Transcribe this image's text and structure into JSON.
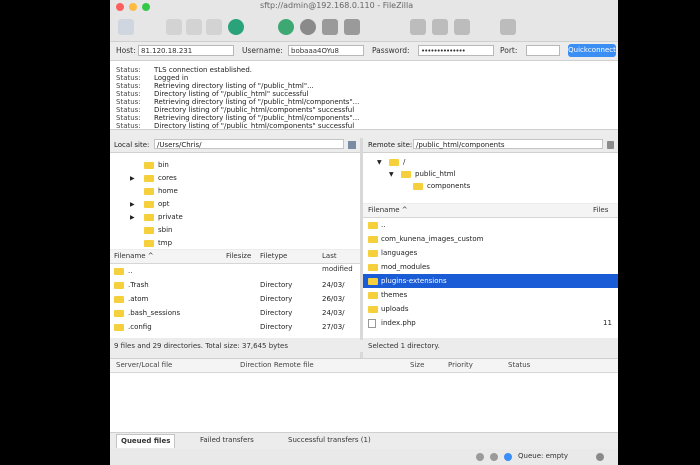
{
  "window": {
    "title": "sftp://admin@192.168.0.110 - FileZilla",
    "traffic_lights": [
      "#fc605c",
      "#fdbc40",
      "#34c84a"
    ]
  },
  "quickconnect": {
    "host_label": "Host:",
    "host_value": "81.120.18.231",
    "username_label": "Username:",
    "username_value": "bobaaa4OYu8",
    "password_label": "Password:",
    "password_value": "••••••••••••••",
    "port_label": "Port:",
    "port_value": "",
    "button_label": "Quickconnect"
  },
  "log": [
    {
      "k": "Status:",
      "v": "TLS connection established."
    },
    {
      "k": "Status:",
      "v": "Logged in"
    },
    {
      "k": "Status:",
      "v": "Retrieving directory listing of \"/public_html\"..."
    },
    {
      "k": "Status:",
      "v": "Directory listing of \"/public_html\" successful"
    },
    {
      "k": "Status:",
      "v": "Retrieving directory listing of \"/public_html/components\"..."
    },
    {
      "k": "Status:",
      "v": "Directory listing of \"/public_html/components\" successful"
    },
    {
      "k": "Status:",
      "v": "Retrieving directory listing of \"/public_html/components\"..."
    },
    {
      "k": "Status:",
      "v": "Directory listing of \"/public_html/components\" successful"
    }
  ],
  "local": {
    "site_label": "Local site:",
    "site_path": "/Users/Chris/",
    "tree": [
      {
        "label": "bin",
        "expander": ""
      },
      {
        "label": "cores",
        "expander": "▶"
      },
      {
        "label": "home",
        "expander": ""
      },
      {
        "label": "opt",
        "expander": "▶"
      },
      {
        "label": "private",
        "expander": "▶"
      },
      {
        "label": "sbin",
        "expander": ""
      },
      {
        "label": "tmp",
        "expander": ""
      }
    ],
    "headers": {
      "name": "Filename ^",
      "size": "Filesize",
      "type": "Filetype",
      "modified": "Last modified"
    },
    "files": [
      {
        "name": "..",
        "size": "",
        "type": "",
        "modified": ""
      },
      {
        "name": ".Trash",
        "size": "",
        "type": "Directory",
        "modified": "24/03/"
      },
      {
        "name": ".atom",
        "size": "",
        "type": "Directory",
        "modified": "26/03/"
      },
      {
        "name": ".bash_sessions",
        "size": "",
        "type": "Directory",
        "modified": "24/03/"
      },
      {
        "name": ".config",
        "size": "",
        "type": "Directory",
        "modified": "27/03/"
      }
    ],
    "status": "9 files and 29 directories. Total size: 37,645 bytes"
  },
  "remote": {
    "site_label": "Remote site:",
    "site_path": "/public_html/components",
    "tree": [
      {
        "label": "/",
        "depth": 0,
        "expander": "▼"
      },
      {
        "label": "public_html",
        "depth": 1,
        "expander": "▼"
      },
      {
        "label": "components",
        "depth": 2,
        "expander": ""
      }
    ],
    "headers": {
      "name": "Filename ^",
      "size": "Files"
    },
    "files": [
      {
        "name": "..",
        "size": "",
        "kind": "folder"
      },
      {
        "name": "com_kunena_images_custom",
        "size": "",
        "kind": "folder"
      },
      {
        "name": "languages",
        "size": "",
        "kind": "folder"
      },
      {
        "name": "mod_modules",
        "size": "",
        "kind": "folder"
      },
      {
        "name": "plugins-extensions",
        "size": "",
        "kind": "folder"
      },
      {
        "name": "themes",
        "size": "",
        "kind": "folder"
      },
      {
        "name": "uploads",
        "size": "",
        "kind": "folder"
      },
      {
        "name": "index.php",
        "size": "11",
        "kind": "file"
      }
    ],
    "selected_index": 4,
    "status": "Selected 1 directory."
  },
  "queue": {
    "headers": {
      "server": "Server/Local file",
      "direction": "Direction  Remote file",
      "size": "Size",
      "priority": "Priority",
      "status": "Status"
    },
    "tabs": [
      "Queued files",
      "Failed transfers",
      "Successful transfers (1)"
    ],
    "active_tab": 0,
    "footer": "Queue: empty"
  }
}
